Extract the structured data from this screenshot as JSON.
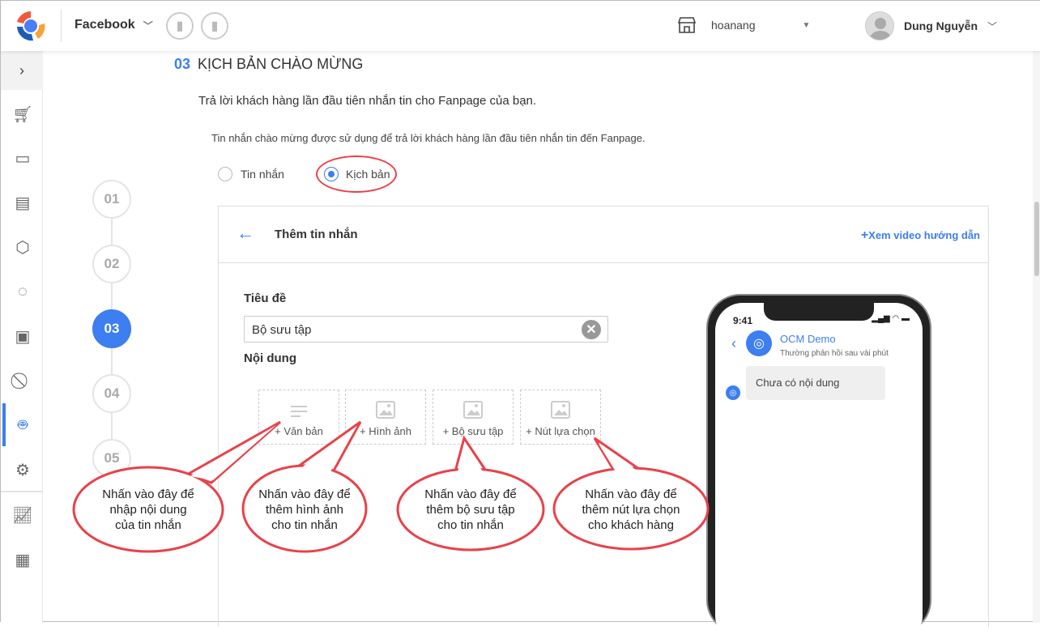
{
  "topbar": {
    "channel": "Facebook",
    "store": "hoanang",
    "user": "Dung Nguyễn"
  },
  "section": {
    "number": "03",
    "title": "KỊCH BẢN CHÀO MỪNG",
    "subtitle": "Trả lời khách hàng lần đầu tiên nhắn tin cho Fanpage của bạn.",
    "description": "Tin nhắn chào mừng được sử dụng để trả lời khách hàng lần đầu tiên nhắn tin đến Fanpage.",
    "radio_options": [
      {
        "label": "Tin nhắn",
        "selected": false
      },
      {
        "label": "Kịch bản",
        "selected": true
      }
    ]
  },
  "steps": [
    "01",
    "02",
    "03",
    "04",
    "05"
  ],
  "panel": {
    "title": "Thêm tin nhắn",
    "video_link": "Xem video hướng dẫn",
    "title_label": "Tiêu đề",
    "title_value": "Bộ sưu tập",
    "content_label": "Nội dung",
    "tiles": [
      "+ Văn bản",
      "+ Hình ảnh",
      "+ Bộ sưu tập",
      "+ Nút lựa chọn"
    ]
  },
  "phone": {
    "time": "9:41",
    "page_name": "OCM Demo",
    "status": "Thường phản hồi sau vài phút",
    "message": "Chưa có nội dung"
  },
  "callouts": [
    [
      "Nhấn vào đây để",
      "nhập nội dung",
      "của tin nhắn"
    ],
    [
      "Nhấn vào đây để",
      "thêm hình ảnh",
      "cho tin nhắn"
    ],
    [
      "Nhấn vào đây để",
      "thêm bộ sưu tập",
      "cho tin nhắn"
    ],
    [
      "Nhấn vào đây để",
      "thêm nút lựa chọn",
      "cho khách hàng"
    ]
  ],
  "colors": {
    "accent": "#3d7ef0",
    "callout_border": "#e8424a"
  }
}
